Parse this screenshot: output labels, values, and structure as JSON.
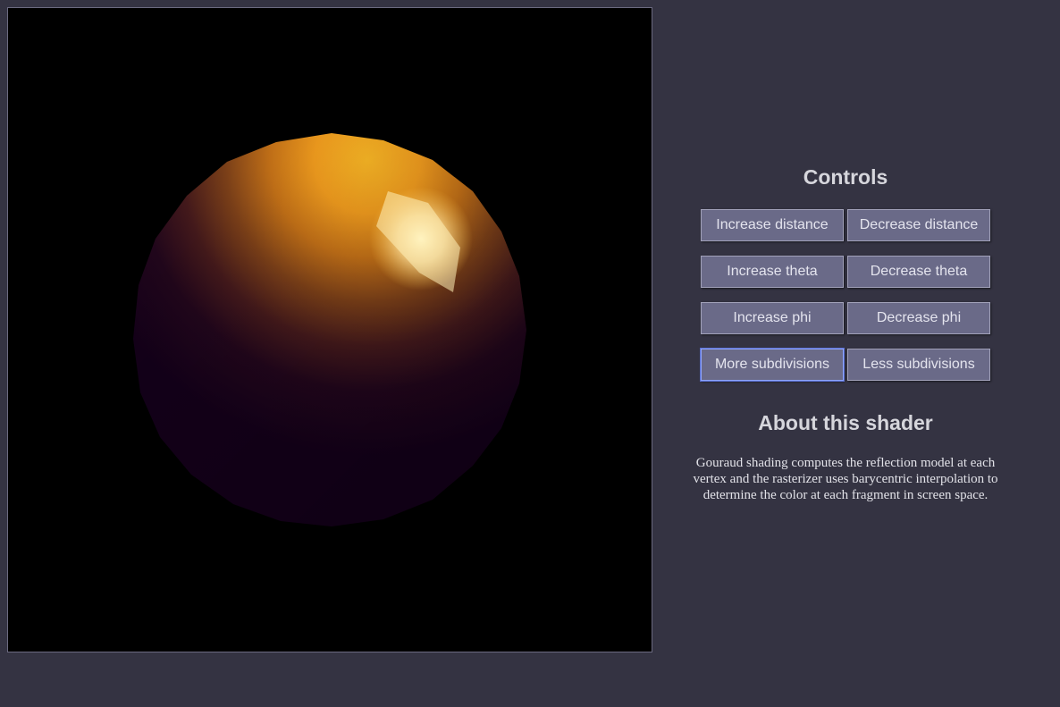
{
  "viewport": {
    "background": "#000000",
    "sphere_base_color": "#1a0118",
    "sphere_lit_color": "#ffb31c",
    "highlight_color": "#fff6c8"
  },
  "controls": {
    "title": "Controls",
    "buttons": [
      {
        "label": "Increase distance"
      },
      {
        "label": "Decrease distance"
      },
      {
        "label": "Increase theta"
      },
      {
        "label": "Decrease theta"
      },
      {
        "label": "Increase phi"
      },
      {
        "label": "Decrease phi"
      },
      {
        "label": "More subdivisions",
        "focused": true
      },
      {
        "label": "Less subdivisions"
      }
    ]
  },
  "about": {
    "title": "About this shader",
    "text": "Gouraud shading computes the reflection model at each vertex and the rasterizer uses barycentric interpolation to determine the color at each fragment in screen space."
  },
  "colors": {
    "page_background": "#343342",
    "button_background": "#6a6a88",
    "button_text": "#e4e4ee",
    "heading_text": "#d6d6dc"
  }
}
